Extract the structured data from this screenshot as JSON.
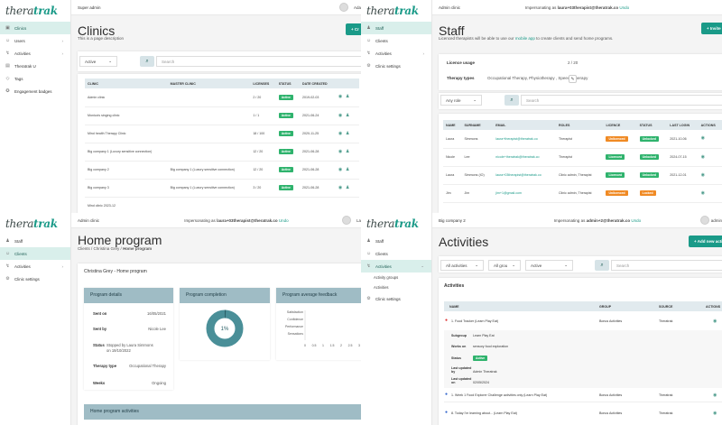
{
  "logo": {
    "a": "thera",
    "b": "trak"
  },
  "q1": {
    "top_left": "Super admin",
    "user": "Ada",
    "nav": [
      {
        "label": "Clinics",
        "icon": "▣",
        "active": true
      },
      {
        "label": "Users",
        "icon": "☺",
        "chev": "›"
      },
      {
        "label": "Activities",
        "icon": "↯",
        "chev": "›"
      },
      {
        "label": "Theratrak U",
        "icon": "▤"
      },
      {
        "label": "Tags",
        "icon": "◇"
      },
      {
        "label": "Engagement badges",
        "icon": "✪"
      }
    ],
    "title": "Clinics",
    "desc": "This is a page description",
    "btn": "+ Cr",
    "filter": "Active",
    "search_ph": "Search",
    "headers": [
      "CLINIC",
      "MASTER CLINIC",
      "LICENSES",
      "STATUS",
      "DATE CREATED"
    ],
    "rows": [
      {
        "c": "Admin clinic",
        "m": "",
        "l": "2 / 20",
        "s": "Active",
        "d": "2019-02-03"
      },
      {
        "c": "Monica's singing clinic",
        "m": "",
        "l": "1 / 1",
        "s": "Active",
        "d": "2021-06-24"
      },
      {
        "c": "Mind health Therapy Clinic",
        "m": "",
        "l": "18 / 100",
        "s": "Active",
        "d": "2020-11-25"
      },
      {
        "c": "Big company 1 (Luxury sensitive connection)",
        "m": "",
        "l": "12 / 20",
        "s": "Active",
        "d": "2021-06-28"
      },
      {
        "c": "Big company 2",
        "m": "Big company 1 (Luxury sensitive connection)",
        "l": "12 / 20",
        "s": "Active",
        "d": "2021-06-28"
      },
      {
        "c": "Big company 3",
        "m": "Big company 1 (Luxury sensitive connection)",
        "l": "3 / 20",
        "s": "Active",
        "d": "2021-06-28"
      },
      {
        "c": "Mind clinic 2023-12",
        "m": "",
        "l": "",
        "s": "",
        "d": ""
      }
    ]
  },
  "q2": {
    "top_left": "Admin clinic",
    "impers": "Impersonating as ",
    "email": "laura+03therapist@theratrak.co",
    "undo": "Undo",
    "nav": [
      {
        "label": "Staff",
        "icon": "♟",
        "active": true
      },
      {
        "label": "Clients",
        "icon": "☺"
      },
      {
        "label": "Activities",
        "icon": "↯",
        "chev": "›"
      },
      {
        "label": "Clinic settings",
        "icon": "⚙"
      }
    ],
    "title": "Staff",
    "btn": "+ Invite",
    "desc1": "Licenced therapists will be able to use our ",
    "desc_link": "mobile app",
    "desc2": " to create clients and send home programs.",
    "lic_label": "Licence usage",
    "lic_val": "2 / 20",
    "ther_label": "Therapy types",
    "ther_val": "Occupational Therapy, Physiotherapy , Speech Therapy",
    "role": "Any role",
    "search_ph": "Search",
    "headers": [
      "NAME",
      "SURNAME",
      "EMAIL",
      "ROLES",
      "LICENCE",
      "STATUS",
      "LAST LOGIN",
      "ACTIONS"
    ],
    "rows": [
      {
        "n": "Laura",
        "s": "Simmons",
        "e": "laura+therapist@theratrak.co",
        "r": "Therapist",
        "l": "Unlicenced",
        "lc": "po",
        "st": "Unlocked",
        "stc": "pg",
        "d": "2021-10-06"
      },
      {
        "n": "Nicole",
        "s": "Lee",
        "e": "nicole+theratrak@theratrak.co",
        "r": "Therapist",
        "l": "Licenced",
        "lc": "pg",
        "st": "Unlocked",
        "stc": "pg",
        "d": "2024-07-15"
      },
      {
        "n": "Laura",
        "s": "Simmons (IO)",
        "e": "laura+03therapist@theratrak.co",
        "r": "Clinic admin, Therapist",
        "l": "Licenced",
        "lc": "pg",
        "st": "Unlocked",
        "stc": "pg",
        "d": "2021-12-01"
      },
      {
        "n": "Jim",
        "s": "Jim",
        "e": "jim+1@gmail.com",
        "r": "Clinic admin, Therapist",
        "l": "Unlicenced",
        "lc": "po",
        "st": "Locked",
        "stc": "po",
        "d": ""
      }
    ]
  },
  "q3": {
    "top_left": "Admin clinic",
    "impers": "Impersonating as ",
    "email": "laura+03therapist@theratrak.co",
    "undo": "Undo",
    "user": "La",
    "nav": [
      {
        "label": "Staff",
        "icon": "♟"
      },
      {
        "label": "Clients",
        "icon": "☺",
        "active": true
      },
      {
        "label": "Activities",
        "icon": "↯",
        "chev": "›"
      },
      {
        "label": "Clinic settings",
        "icon": "⚙"
      }
    ],
    "title": "Home program",
    "crumb": [
      "Clients",
      "Christina Grey",
      "Home program"
    ],
    "sub": "Christina Grey - Home program",
    "details_title": "Program details",
    "details": [
      {
        "k": "Sent on",
        "v": "16/05/2021"
      },
      {
        "k": "Sent by",
        "v": "Nicole Lee"
      },
      {
        "k": "Status",
        "v": "Stopped by Laura Simmons on 19/10/2022"
      },
      {
        "k": "Therapy type",
        "v": "Occupational Therapy"
      },
      {
        "k": "Weeks",
        "v": "Ongoing"
      }
    ],
    "comp_title": "Program completion",
    "comp_val": "1%",
    "comp_fraction": 0.01,
    "fb_title": "Program average feedback",
    "fb_labels": [
      "Satisfaction",
      "Confidence",
      "Performance",
      "Sensations"
    ],
    "fb_ticks": [
      "0",
      "0.5",
      "1",
      "1.5",
      "2",
      "2.5",
      "3"
    ],
    "act_title": "Home program activities"
  },
  "q4": {
    "top_left": "Big company 2",
    "impers": "Impersonating as ",
    "email": "admin+2@theratrak.co",
    "undo": "Undo",
    "user": "admin",
    "nav": [
      {
        "label": "Staff",
        "icon": "♟"
      },
      {
        "label": "Clients",
        "icon": "☺"
      },
      {
        "label": "Activities",
        "icon": "↯",
        "chev": "⌄",
        "active": true
      },
      {
        "label": "Clinic settings",
        "icon": "⚙"
      }
    ],
    "subnav": [
      "Activity groups",
      "Activities"
    ],
    "title": "Activities",
    "btn": "+ Add new acti",
    "f1": "All activities",
    "f2": "All grou",
    "f3": "Active",
    "search_ph": "Search",
    "card_title": "Activities",
    "headers": [
      "NAME",
      "GROUP",
      "SOURCE",
      "ACTIONS"
    ],
    "r1": {
      "n": "1. Food Tracker (Learn Play Eat)",
      "g": "Bonus Activities",
      "s": "Theratrak"
    },
    "exp": [
      {
        "k": "Subgroup",
        "v": "Learn Play Eat"
      },
      {
        "k": "Works on",
        "v": "sensory food exploration"
      },
      {
        "k": "Status",
        "v": "Active"
      },
      {
        "k": "Last updated by",
        "v": "Admin Theratrak"
      },
      {
        "k": "Last updated on",
        "v": "02/05/2024"
      }
    ],
    "r2": {
      "n": "1. Week 1 Food Explorer Challenge activities only (Learn Play Eat)",
      "g": "Bonus Activities",
      "s": "Theratrak"
    },
    "r3": {
      "n": "8. Today I'm learning about... (Learn Play Eat)",
      "g": "Bonus Activities",
      "s": "Theratrak"
    }
  }
}
